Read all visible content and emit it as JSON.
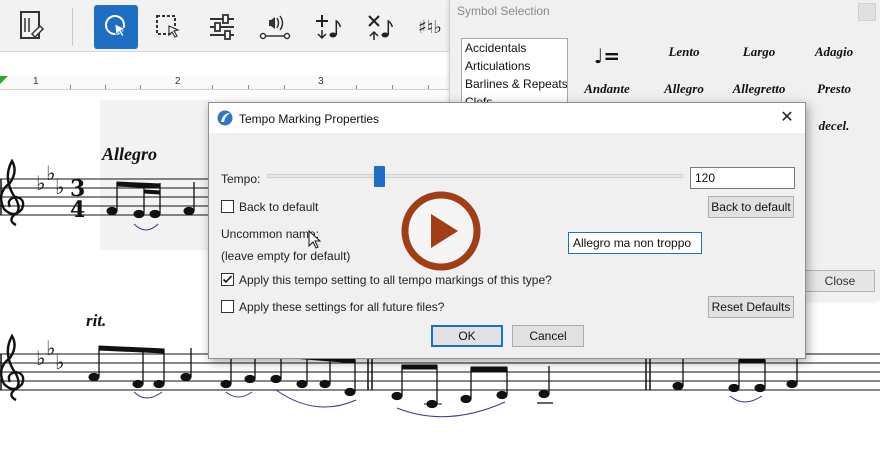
{
  "toolbar": {
    "buttons": [
      {
        "name": "score-setup-icon"
      },
      {
        "name": "selection-tool-icon",
        "active": true
      },
      {
        "name": "marquee-select-icon"
      },
      {
        "name": "mixer-sliders-icon"
      },
      {
        "name": "sound-line-icon"
      },
      {
        "name": "add-note-icon"
      },
      {
        "name": "delete-note-icon"
      },
      {
        "name": "accidentals-icon"
      }
    ],
    "accent_color": "#1d6fc4"
  },
  "ruler": {
    "marks": [
      "1",
      "2",
      "3"
    ]
  },
  "score": {
    "tempo_text": "Allegro",
    "rit_text": "rit.",
    "time_signature": {
      "top": "3",
      "bottom": "4"
    }
  },
  "symbol_panel": {
    "title": "Symbol Selection",
    "categories": [
      "Accidentals",
      "Articulations",
      "Barlines & Repeats",
      "Clefs"
    ],
    "symbols": [
      "Lento",
      "Largo",
      "Adagio",
      "Andante",
      "Allegro",
      "Allegretto",
      "Presto",
      "decel."
    ],
    "metronome_symbol": "♩=",
    "close_label": "Close"
  },
  "dialog": {
    "title": "Tempo Marking Properties",
    "close_glyph": "✕",
    "tempo_label": "Tempo:",
    "tempo_value": "120",
    "tempo_fraction": 0.27,
    "back_to_default_check_label": "Back to default",
    "back_to_default_button": "Back to default",
    "uncommon_name_label": "Uncommon name:",
    "uncommon_name_hint": "(leave empty for default)",
    "uncommon_name_value": "Allegro ma non troppo",
    "apply_all_label": "Apply this tempo setting to all tempo markings of this type?",
    "apply_all_checked": true,
    "apply_future_label": "Apply these settings for all future files?",
    "apply_future_checked": false,
    "reset_defaults_button": "Reset Defaults",
    "ok_button": "OK",
    "cancel_button": "Cancel"
  },
  "overlay": {
    "play_color": "#a23d16"
  }
}
